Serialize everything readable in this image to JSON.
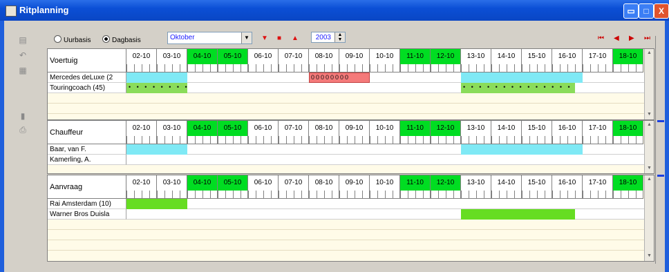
{
  "window": {
    "title": "Ritplanning",
    "min_glyph": "▭",
    "max_glyph": "□",
    "close_glyph": "X"
  },
  "toolbar": {
    "mode_options": [
      "Uurbasis",
      "Dagbasis"
    ],
    "selected_mode": "Dagbasis",
    "month": "Oktober",
    "year": "2003",
    "down_glyph": "▼",
    "square_glyph": "■",
    "up_glyph": "▲",
    "nav_glyphs": [
      "⏮",
      "◀",
      "▶",
      "⏭"
    ]
  },
  "days": [
    {
      "label": "02-10",
      "hol": false
    },
    {
      "label": "03-10",
      "hol": false
    },
    {
      "label": "04-10",
      "hol": true
    },
    {
      "label": "05-10",
      "hol": true
    },
    {
      "label": "06-10",
      "hol": false
    },
    {
      "label": "07-10",
      "hol": false
    },
    {
      "label": "08-10",
      "hol": false
    },
    {
      "label": "09-10",
      "hol": false
    },
    {
      "label": "10-10",
      "hol": false
    },
    {
      "label": "11-10",
      "hol": true
    },
    {
      "label": "12-10",
      "hol": true
    },
    {
      "label": "13-10",
      "hol": false
    },
    {
      "label": "14-10",
      "hol": false
    },
    {
      "label": "15-10",
      "hol": false
    },
    {
      "label": "16-10",
      "hol": false
    },
    {
      "label": "17-10",
      "hol": false
    },
    {
      "label": "18-10",
      "hol": true
    }
  ],
  "sections": {
    "vehicles": {
      "title": "Voertuig",
      "rows": [
        {
          "label": "Mercedes deLuxe (2",
          "bars": [
            {
              "start": 0,
              "end": 2,
              "color": "cyan"
            },
            {
              "start": 6,
              "end": 8,
              "color": "pink",
              "text": "00000000"
            },
            {
              "start": 11,
              "end": 15,
              "color": "cyan"
            }
          ]
        },
        {
          "label": "Touringcoach (45)",
          "bars": [
            {
              "start": 0,
              "end": 2,
              "color": "dots",
              "text": "• • • • • • • •"
            },
            {
              "start": 11,
              "end": 14.75,
              "color": "dots",
              "text": "• • • • • • • • • • • • • • • •"
            }
          ]
        }
      ]
    },
    "drivers": {
      "title": "Chauffeur",
      "rows": [
        {
          "label": "Baar, van F.",
          "bars": [
            {
              "start": 0,
              "end": 2,
              "color": "cyan"
            },
            {
              "start": 11,
              "end": 15,
              "color": "cyan"
            }
          ]
        },
        {
          "label": "Kamerling, A.",
          "bars": []
        }
      ]
    },
    "requests": {
      "title": "Aanvraag",
      "rows": [
        {
          "label": "Rai Amsterdam (10)",
          "bars": [
            {
              "start": 0,
              "end": 2,
              "color": "green2"
            }
          ]
        },
        {
          "label": "Warner Bros Duisla",
          "bars": [
            {
              "start": 11,
              "end": 14.75,
              "color": "green2"
            }
          ]
        }
      ]
    }
  }
}
